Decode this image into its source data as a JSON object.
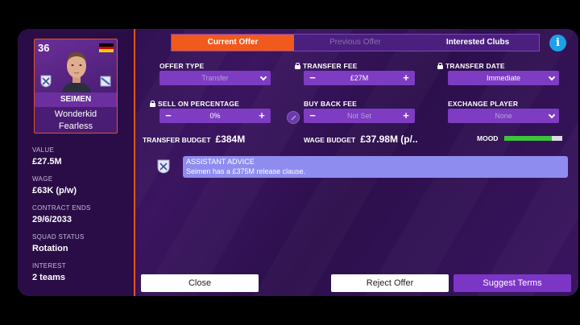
{
  "player": {
    "rating": "36",
    "name": "SEIMEN",
    "traits": [
      "Wonderkid",
      "Fearless"
    ],
    "flag_colors": [
      "#000000",
      "#dd0000",
      "#ffce00"
    ]
  },
  "info": [
    {
      "label": "VALUE",
      "value": "£27.5M"
    },
    {
      "label": "WAGE",
      "value": "£63K (p/w)"
    },
    {
      "label": "CONTRACT ENDS",
      "value": "29/6/2033"
    },
    {
      "label": "SQUAD STATUS",
      "value": "Rotation"
    },
    {
      "label": "INTEREST",
      "value": "2 teams"
    }
  ],
  "tabs": [
    {
      "label": "Current Offer",
      "active": true
    },
    {
      "label": "Previous Offer",
      "active": false
    },
    {
      "label": "Interested Clubs",
      "active": false
    }
  ],
  "fields": {
    "offer_type": {
      "label": "OFFER TYPE",
      "value": "Transfer"
    },
    "transfer_fee": {
      "label": "TRANSFER FEE",
      "value": "£27M"
    },
    "transfer_date": {
      "label": "TRANSFER DATE",
      "value": "Immediate"
    },
    "sell_on": {
      "label": "SELL ON PERCENTAGE",
      "value": "0%"
    },
    "buy_back": {
      "label": "BUY BACK FEE",
      "value": "Not Set"
    },
    "exchange": {
      "label": "EXCHANGE PLAYER",
      "value": "None"
    }
  },
  "stats": {
    "budget_label": "TRANSFER BUDGET",
    "budget_value": "£384M",
    "wage_label": "WAGE BUDGET",
    "wage_value": "£37.98M (p/..",
    "mood_label": "MOOD",
    "mood_level": 0.82
  },
  "advice": {
    "title": "ASSISTANT ADVICE",
    "body": "Seimen has a £375M release clause."
  },
  "buttons": {
    "close": "Close",
    "reject": "Reject Offer",
    "suggest": "Suggest Terms"
  },
  "colors": {
    "accent": "#f05a1c",
    "panel": "#7d3cc2",
    "info": "#1ea0e6",
    "advice": "#8f8cf0"
  }
}
